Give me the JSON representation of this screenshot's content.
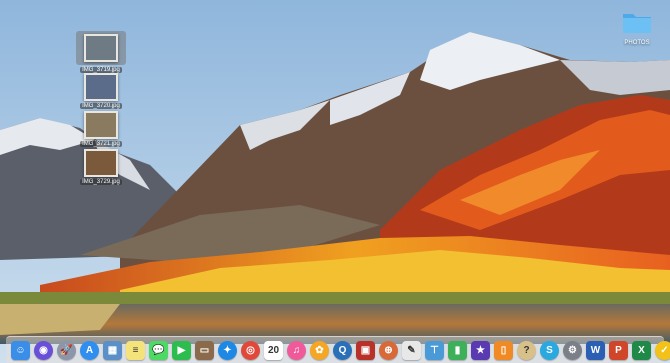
{
  "desktop": {
    "photos": [
      {
        "label": "IMG_3719.jpg",
        "selected": true
      },
      {
        "label": "IMG_3720.jpg",
        "selected": false
      },
      {
        "label": "IMG_3721.jpg",
        "selected": false
      },
      {
        "label": "IMG_3729.jpg",
        "selected": false
      }
    ],
    "folder": {
      "label": "PHOTOS"
    }
  },
  "dock": {
    "apps": [
      {
        "name": "finder-icon",
        "glyph": "☺",
        "color": "#3a8ee8"
      },
      {
        "name": "siri-icon",
        "glyph": "◉",
        "color": "#6a4fd8",
        "round": true
      },
      {
        "name": "launchpad-icon",
        "glyph": "🚀",
        "color": "#8c96a8",
        "round": true
      },
      {
        "name": "app-store-icon",
        "glyph": "A",
        "color": "#2f8ef0",
        "round": true
      },
      {
        "name": "preview-icon",
        "glyph": "▦",
        "color": "#5b8fc8"
      },
      {
        "name": "notes-icon",
        "glyph": "≡",
        "color": "#f4e27a"
      },
      {
        "name": "messages-icon",
        "glyph": "💬",
        "color": "#4cd964"
      },
      {
        "name": "facetime-icon",
        "glyph": "▶",
        "color": "#2dbd4e"
      },
      {
        "name": "keynote-icon",
        "glyph": "▭",
        "color": "#8a6a4a"
      },
      {
        "name": "safari-icon",
        "glyph": "✦",
        "color": "#1e88e5",
        "round": true
      },
      {
        "name": "chrome-icon",
        "glyph": "◎",
        "color": "#e0493a",
        "round": true
      },
      {
        "name": "calendar-icon",
        "glyph": "20",
        "color": "#ffffff"
      },
      {
        "name": "itunes-icon",
        "glyph": "♫",
        "color": "#f05a9a",
        "round": true
      },
      {
        "name": "photos-icon",
        "glyph": "✿",
        "color": "#f5a623",
        "round": true
      },
      {
        "name": "quicktime-icon",
        "glyph": "Q",
        "color": "#2a6fb8",
        "round": true
      },
      {
        "name": "photo-booth-icon",
        "glyph": "▣",
        "color": "#b8322a"
      },
      {
        "name": "screenshot-icon",
        "glyph": "⊕",
        "color": "#d86a3a",
        "round": true
      },
      {
        "name": "textedit-icon",
        "glyph": "✎",
        "color": "#e8e8e8"
      },
      {
        "name": "keynote-stand-icon",
        "glyph": "⊤",
        "color": "#4a9ad8"
      },
      {
        "name": "numbers-icon",
        "glyph": "▮",
        "color": "#3fb05a"
      },
      {
        "name": "imovie-icon",
        "glyph": "★",
        "color": "#5a3ab0"
      },
      {
        "name": "ibooks-icon",
        "glyph": "▯",
        "color": "#f08a24"
      },
      {
        "name": "help-icon",
        "glyph": "?",
        "color": "#d8c08a",
        "round": true
      },
      {
        "name": "skype-icon",
        "glyph": "S",
        "color": "#2aa8e0",
        "round": true
      },
      {
        "name": "system-preferences-icon",
        "glyph": "⚙",
        "color": "#7a7f88",
        "round": true
      },
      {
        "name": "word-icon",
        "glyph": "W",
        "color": "#2b5fb4"
      },
      {
        "name": "powerpoint-icon",
        "glyph": "P",
        "color": "#d0462a"
      },
      {
        "name": "excel-icon",
        "glyph": "X",
        "color": "#1f8a48"
      },
      {
        "name": "norton-icon",
        "glyph": "✓",
        "color": "#f2c218",
        "round": true
      },
      {
        "name": "finder-downloads-icon",
        "glyph": "⇩",
        "color": "#e8eaee"
      },
      {
        "name": "image-capture-icon",
        "glyph": "▤",
        "color": "#bcc8d8"
      }
    ],
    "trash": {
      "name": "trash-icon",
      "glyph": "🗑",
      "color": "#d8dde3"
    }
  }
}
